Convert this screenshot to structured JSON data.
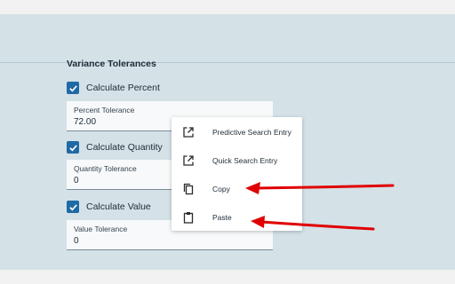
{
  "section": {
    "title": "Variance Tolerances"
  },
  "checks": [
    {
      "label": "Calculate Percent",
      "checked": true
    },
    {
      "label": "Calculate Quantity",
      "checked": true
    },
    {
      "label": "Calculate Value",
      "checked": true
    }
  ],
  "fields": [
    {
      "label": "Percent Tolerance",
      "value": "72.00"
    },
    {
      "label": "Quantity Tolerance",
      "value": "0"
    },
    {
      "label": "Value Tolerance",
      "value": "0"
    }
  ],
  "context_menu": {
    "items": [
      {
        "label": "Predictive Search Entry",
        "icon": "open-in-new-icon"
      },
      {
        "label": "Quick Search Entry",
        "icon": "open-in-new-icon"
      },
      {
        "label": "Copy",
        "icon": "copy-icon"
      },
      {
        "label": "Paste",
        "icon": "clipboard-icon"
      }
    ]
  },
  "colors": {
    "accent": "#1f6aa5",
    "panel_bg": "#d4e1e7",
    "annotation_arrow": "#e00000"
  }
}
